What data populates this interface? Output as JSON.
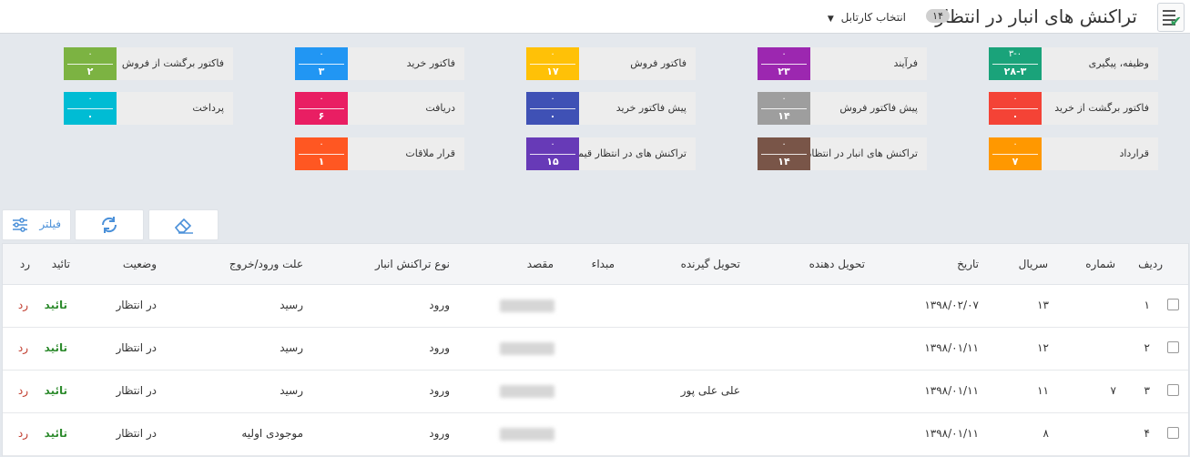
{
  "header": {
    "title": "تراکنش های انبار در انتظار",
    "title_count": "۱۴",
    "kartabl_label": "انتخاب کارتابل"
  },
  "tiles": [
    {
      "label": "وظیفه، پیگیری",
      "top": "۳-۰",
      "bottom": "۲۸-۳",
      "color": "#1aa37a"
    },
    {
      "label": "فرآیند",
      "top": "۰",
      "bottom": "۲۳",
      "color": "#9c27b0"
    },
    {
      "label": "فاکتور فروش",
      "top": "۰",
      "bottom": "۱۷",
      "color": "#ffc107"
    },
    {
      "label": "فاکتور خرید",
      "top": "۰",
      "bottom": "۳",
      "color": "#2196f3"
    },
    {
      "label": "فاکتور برگشت از فروش",
      "top": "۰",
      "bottom": "۲",
      "color": "#7cb342"
    },
    {
      "label": "فاکتور برگشت از خرید",
      "top": "۰",
      "bottom": "۰",
      "color": "#f44336"
    },
    {
      "label": "پیش فاکتور فروش",
      "top": "۰",
      "bottom": "۱۴",
      "color": "#9e9e9e"
    },
    {
      "label": "پیش فاکتور خرید",
      "top": "۰",
      "bottom": "۰",
      "color": "#3f51b5"
    },
    {
      "label": "دریافت",
      "top": "۰",
      "bottom": "۶",
      "color": "#e91e63"
    },
    {
      "label": "پرداخت",
      "top": "۰",
      "bottom": "۰",
      "color": "#00bcd4"
    },
    {
      "label": "قرارداد",
      "top": "۰",
      "bottom": "۷",
      "color": "#ff9800"
    },
    {
      "label": "تراکنش های انبار در انتظار",
      "top": "۰",
      "bottom": "۱۴",
      "color": "#795548"
    },
    {
      "label": "تراکنش های در انتظار قیمت گذاری",
      "top": "۰",
      "bottom": "۱۵",
      "color": "#673ab7"
    },
    {
      "label": "قرار ملاقات",
      "top": "۰",
      "bottom": "۱",
      "color": "#ff5722"
    }
  ],
  "toolbar": {
    "filter_label": "فیلتر",
    "icons": [
      "filter-sliders-icon",
      "refresh-icon",
      "eraser-icon"
    ]
  },
  "table": {
    "columns": {
      "row": "ردیف",
      "number": "شماره",
      "serial": "سریال",
      "date": "تاریخ",
      "deliverer": "تحویل دهنده",
      "receiver": "تحویل گیرنده",
      "origin": "مبداء",
      "destination": "مقصد",
      "type": "نوع تراکنش انبار",
      "reason": "علت ورود/خروج",
      "status": "وضعیت",
      "approve": "تائید",
      "reject": "رد"
    },
    "rows": [
      {
        "row": "۱",
        "number": "",
        "serial": "۱۳",
        "date": "۱۳۹۸/۰۲/۰۷",
        "deliverer": "",
        "receiver": "",
        "origin": "",
        "type": "ورود",
        "reason": "رسید",
        "status": "در انتظار",
        "approve": "تائید",
        "reject": "رد"
      },
      {
        "row": "۲",
        "number": "",
        "serial": "۱۲",
        "date": "۱۳۹۸/۰۱/۱۱",
        "deliverer": "",
        "receiver": "",
        "origin": "",
        "type": "ورود",
        "reason": "رسید",
        "status": "در انتظار",
        "approve": "تائید",
        "reject": "رد"
      },
      {
        "row": "۳",
        "number": "۷",
        "serial": "۱۱",
        "date": "۱۳۹۸/۰۱/۱۱",
        "deliverer": "",
        "receiver": "علی علی پور",
        "origin": "",
        "type": "ورود",
        "reason": "رسید",
        "status": "در انتظار",
        "approve": "تائید",
        "reject": "رد"
      },
      {
        "row": "۴",
        "number": "",
        "serial": "۸",
        "date": "۱۳۹۸/۰۱/۱۱",
        "deliverer": "",
        "receiver": "",
        "origin": "",
        "type": "ورود",
        "reason": "موجودی اولیه",
        "status": "در انتظار",
        "approve": "تائید",
        "reject": "رد"
      }
    ]
  }
}
